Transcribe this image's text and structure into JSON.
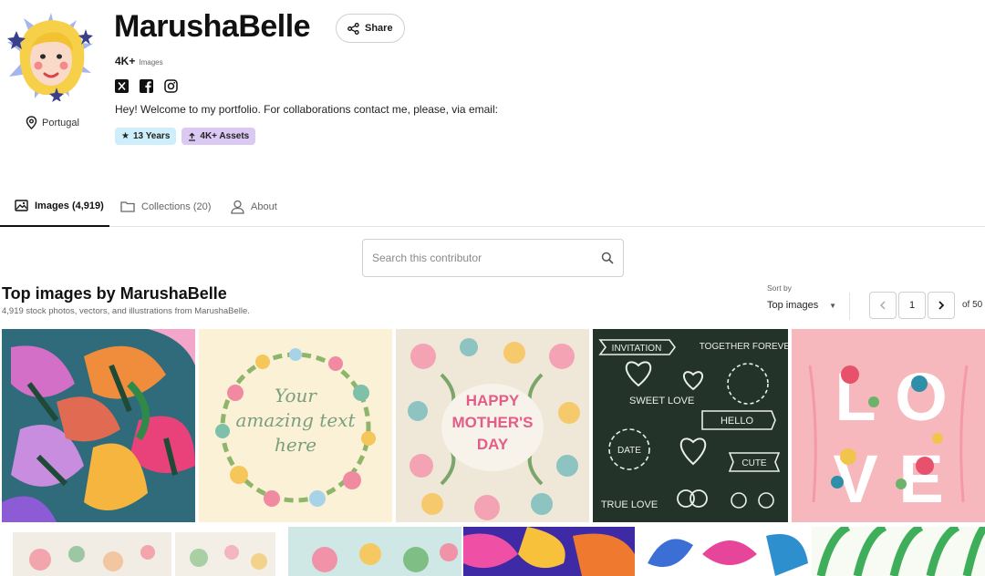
{
  "profile": {
    "name": "MarushaBelle",
    "share_label": "Share",
    "stats_count": "4K+",
    "stats_unit": "Images",
    "location": "Portugal",
    "bio": "Hey! Welcome to my portfolio. For collaborations contact me, please, via email:",
    "social_icons": [
      "x-icon",
      "facebook-icon",
      "instagram-icon"
    ],
    "badges": [
      {
        "icon": "star-icon",
        "label": "13 Years",
        "color": "#cdeefa"
      },
      {
        "icon": "upload-icon",
        "label": "4K+ Assets",
        "color": "#dcc9f3"
      }
    ]
  },
  "tabs": [
    {
      "icon": "image-icon",
      "label": "Images (4,919)",
      "active": true
    },
    {
      "icon": "folder-icon",
      "label": "Collections (20)",
      "active": false
    },
    {
      "icon": "person-icon",
      "label": "About",
      "active": false
    }
  ],
  "search": {
    "placeholder": "Search this contributor"
  },
  "section": {
    "title": "Top images by MarushaBelle",
    "subtitle": "4,919 stock photos, vectors, and illustrations from MarushaBelle."
  },
  "sort": {
    "label": "Sort by",
    "value": "Top images"
  },
  "pagination": {
    "current": "1",
    "total_label": "of 50"
  },
  "images": [
    {
      "name": "tropical-flowers-pattern",
      "text": ""
    },
    {
      "name": "floral-wreath-text",
      "text": "Your amazing text here"
    },
    {
      "name": "happy-mothers-day",
      "text": "HAPPY MOTHER'S DAY"
    },
    {
      "name": "chalkboard-doodles",
      "text": "INVITATION TOGETHER FOREVER SWEET LOVE HELLO DATE CUTE TRUE LOVE"
    },
    {
      "name": "love-floral-letters",
      "text": "LOVE"
    }
  ],
  "colors": {
    "accent_dark": "#111111",
    "border": "#cfcfcf",
    "muted_text": "#666666"
  }
}
